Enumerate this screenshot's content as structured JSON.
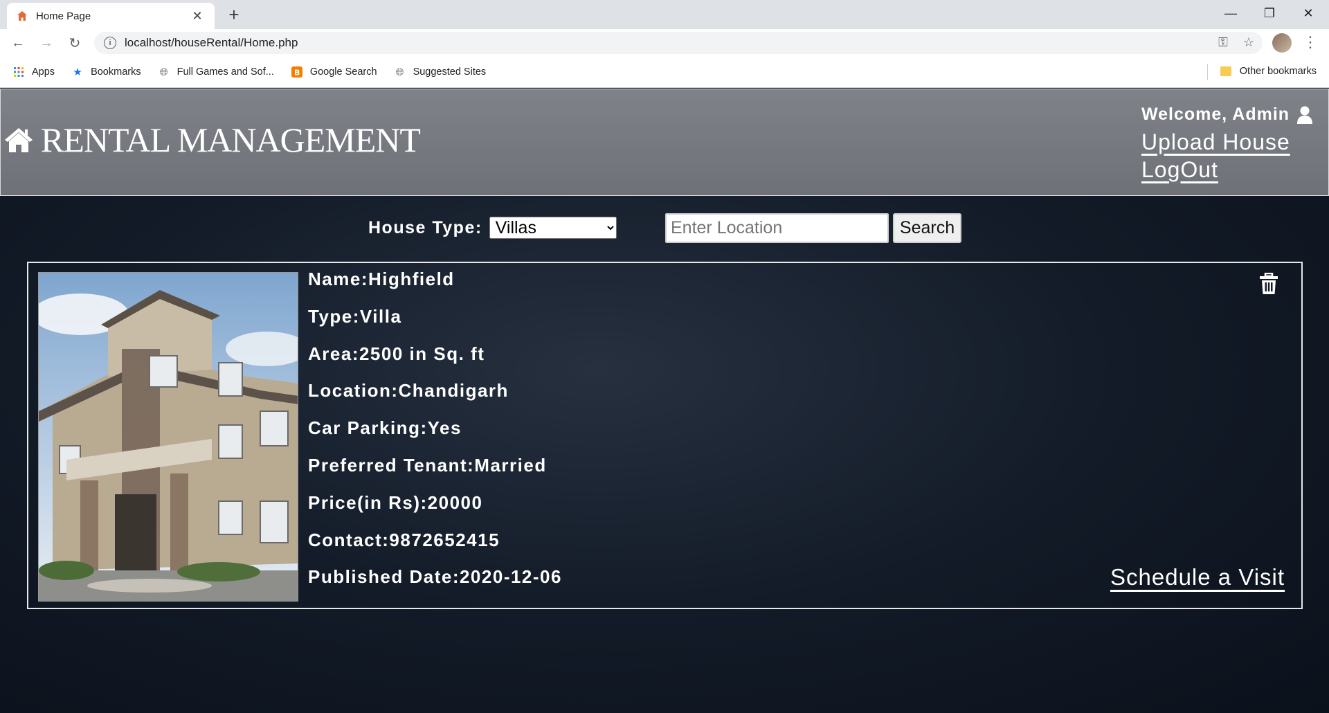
{
  "browser": {
    "tab_title": "Home Page",
    "url": "localhost/houseRental/Home.php",
    "bookmarks": [
      {
        "label": "Apps",
        "icon": "apps-grid-icon"
      },
      {
        "label": "Bookmarks",
        "icon": "star-icon"
      },
      {
        "label": "Full Games and Sof...",
        "icon": "globe-icon"
      },
      {
        "label": "Google Search",
        "icon": "blogger-icon"
      },
      {
        "label": "Suggested Sites",
        "icon": "globe-icon"
      }
    ],
    "other_bookmarks": "Other bookmarks"
  },
  "header": {
    "brand": "RENTAL MANAGEMENT",
    "welcome": "Welcome, Admin",
    "upload_link": "Upload House",
    "logout_link": "LogOut"
  },
  "filter": {
    "house_type_label": "House Type:",
    "house_type_value": "Villas",
    "location_placeholder": "Enter Location",
    "search_label": "Search"
  },
  "listing": {
    "name": "Name:Highfield",
    "type": "Type:Villa",
    "area": "Area:2500 in Sq. ft",
    "location": "Location:Chandigarh",
    "parking": "Car Parking:Yes",
    "tenant": "Preferred Tenant:Married",
    "price": "Price(in Rs):20000",
    "contact": "Contact:9872652415",
    "published": "Published Date:2020-12-06",
    "schedule_link": "Schedule a Visit"
  },
  "colors": {
    "header_bg": "#777a80",
    "page_bg": "#131b28",
    "text": "#ffffff"
  }
}
